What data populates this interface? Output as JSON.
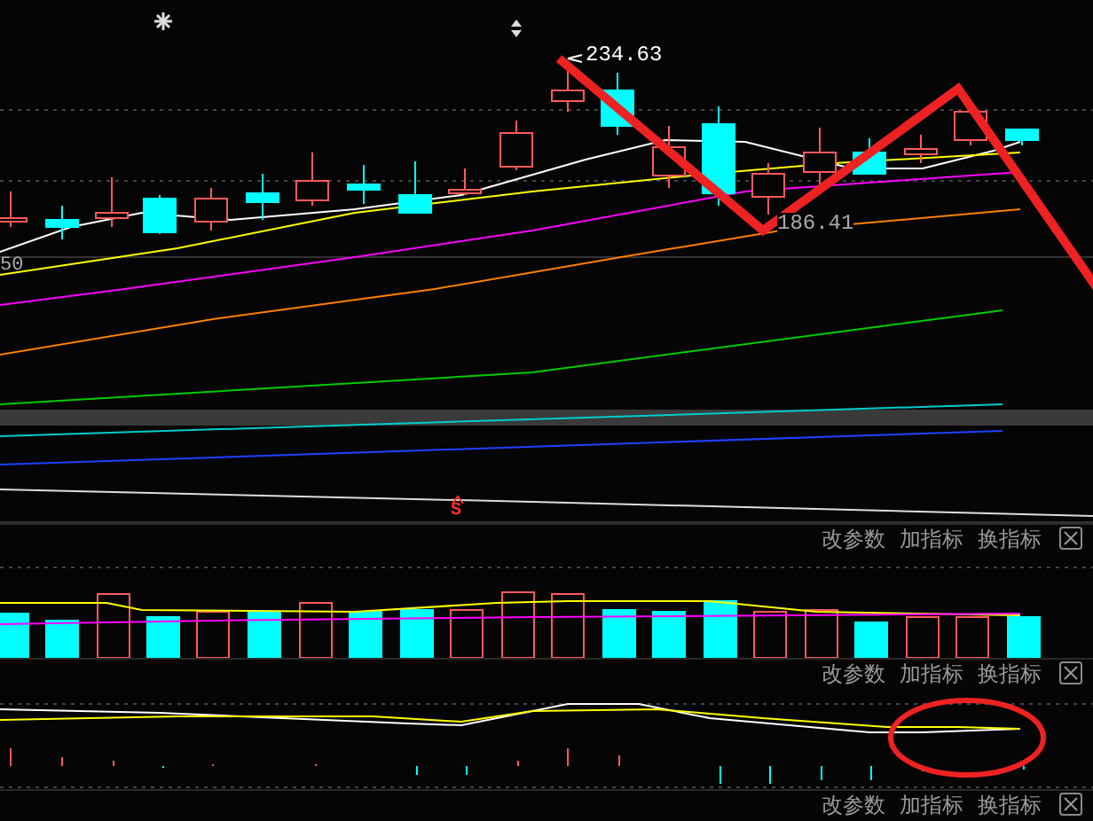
{
  "main_chart": {
    "peak_label": "234.63",
    "trough_label": "186.41",
    "axis_label": "50",
    "signal_marker": "S"
  },
  "indicator_panels": [
    {
      "kind": "volume",
      "buttons": [
        "改参数",
        "加指标",
        "换指标"
      ]
    },
    {
      "kind": "oscillator",
      "buttons": [
        "改参数",
        "加指标",
        "换指标"
      ]
    },
    {
      "kind": "empty",
      "buttons": [
        "改参数",
        "加指标",
        "换指标"
      ]
    }
  ]
}
